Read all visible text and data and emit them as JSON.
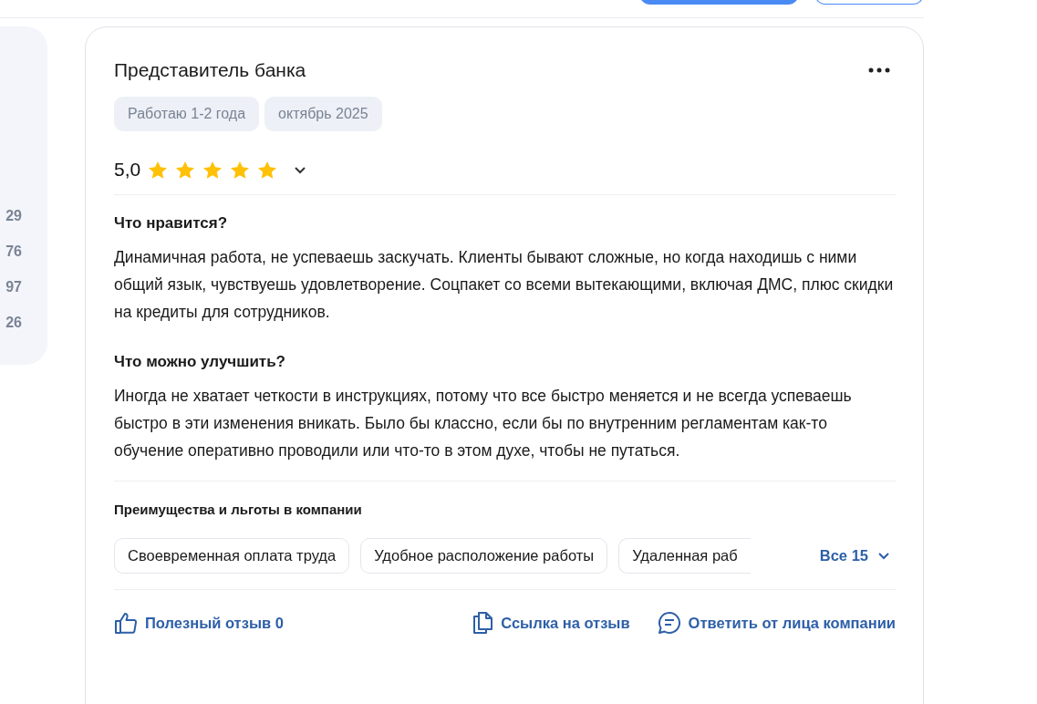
{
  "side_panel": {
    "numbers": [
      "29",
      "76",
      "97",
      "26"
    ]
  },
  "review": {
    "title": "Представитель банка",
    "tags": [
      "Работаю 1-2 года",
      "октябрь 2025"
    ],
    "rating": "5,0",
    "stars": 5,
    "sections": [
      {
        "heading": "Что нравится?",
        "text": "Динамичная работа, не успеваешь заскучать. Клиенты бывают сложные, но когда находишь с ними общий язык, чувствуешь удовлетворение. Соцпакет со всеми вытекающими, включая ДМС, плюс скидки на кредиты для сотрудников."
      },
      {
        "heading": "Что можно улучшить?",
        "text": "Иногда не хватает четкости в инструкциях, потому что все быстро меняется и не всегда успеваешь быстро в эти изменения вникать. Было бы классно, если бы по внутренним регламентам как-то обучение оперативно проводили или что-то в этом духе, чтобы не путаться."
      }
    ],
    "benefits": {
      "heading": "Преимущества и льготы в компании",
      "items": [
        "Своевременная оплата труда",
        "Удобное расположение работы",
        "Удаленная раб"
      ],
      "more": "Все 15"
    },
    "actions": {
      "helpful": "Полезный отзыв 0",
      "link": "Ссылка на отзыв",
      "reply": "Ответить от лица компании"
    }
  }
}
